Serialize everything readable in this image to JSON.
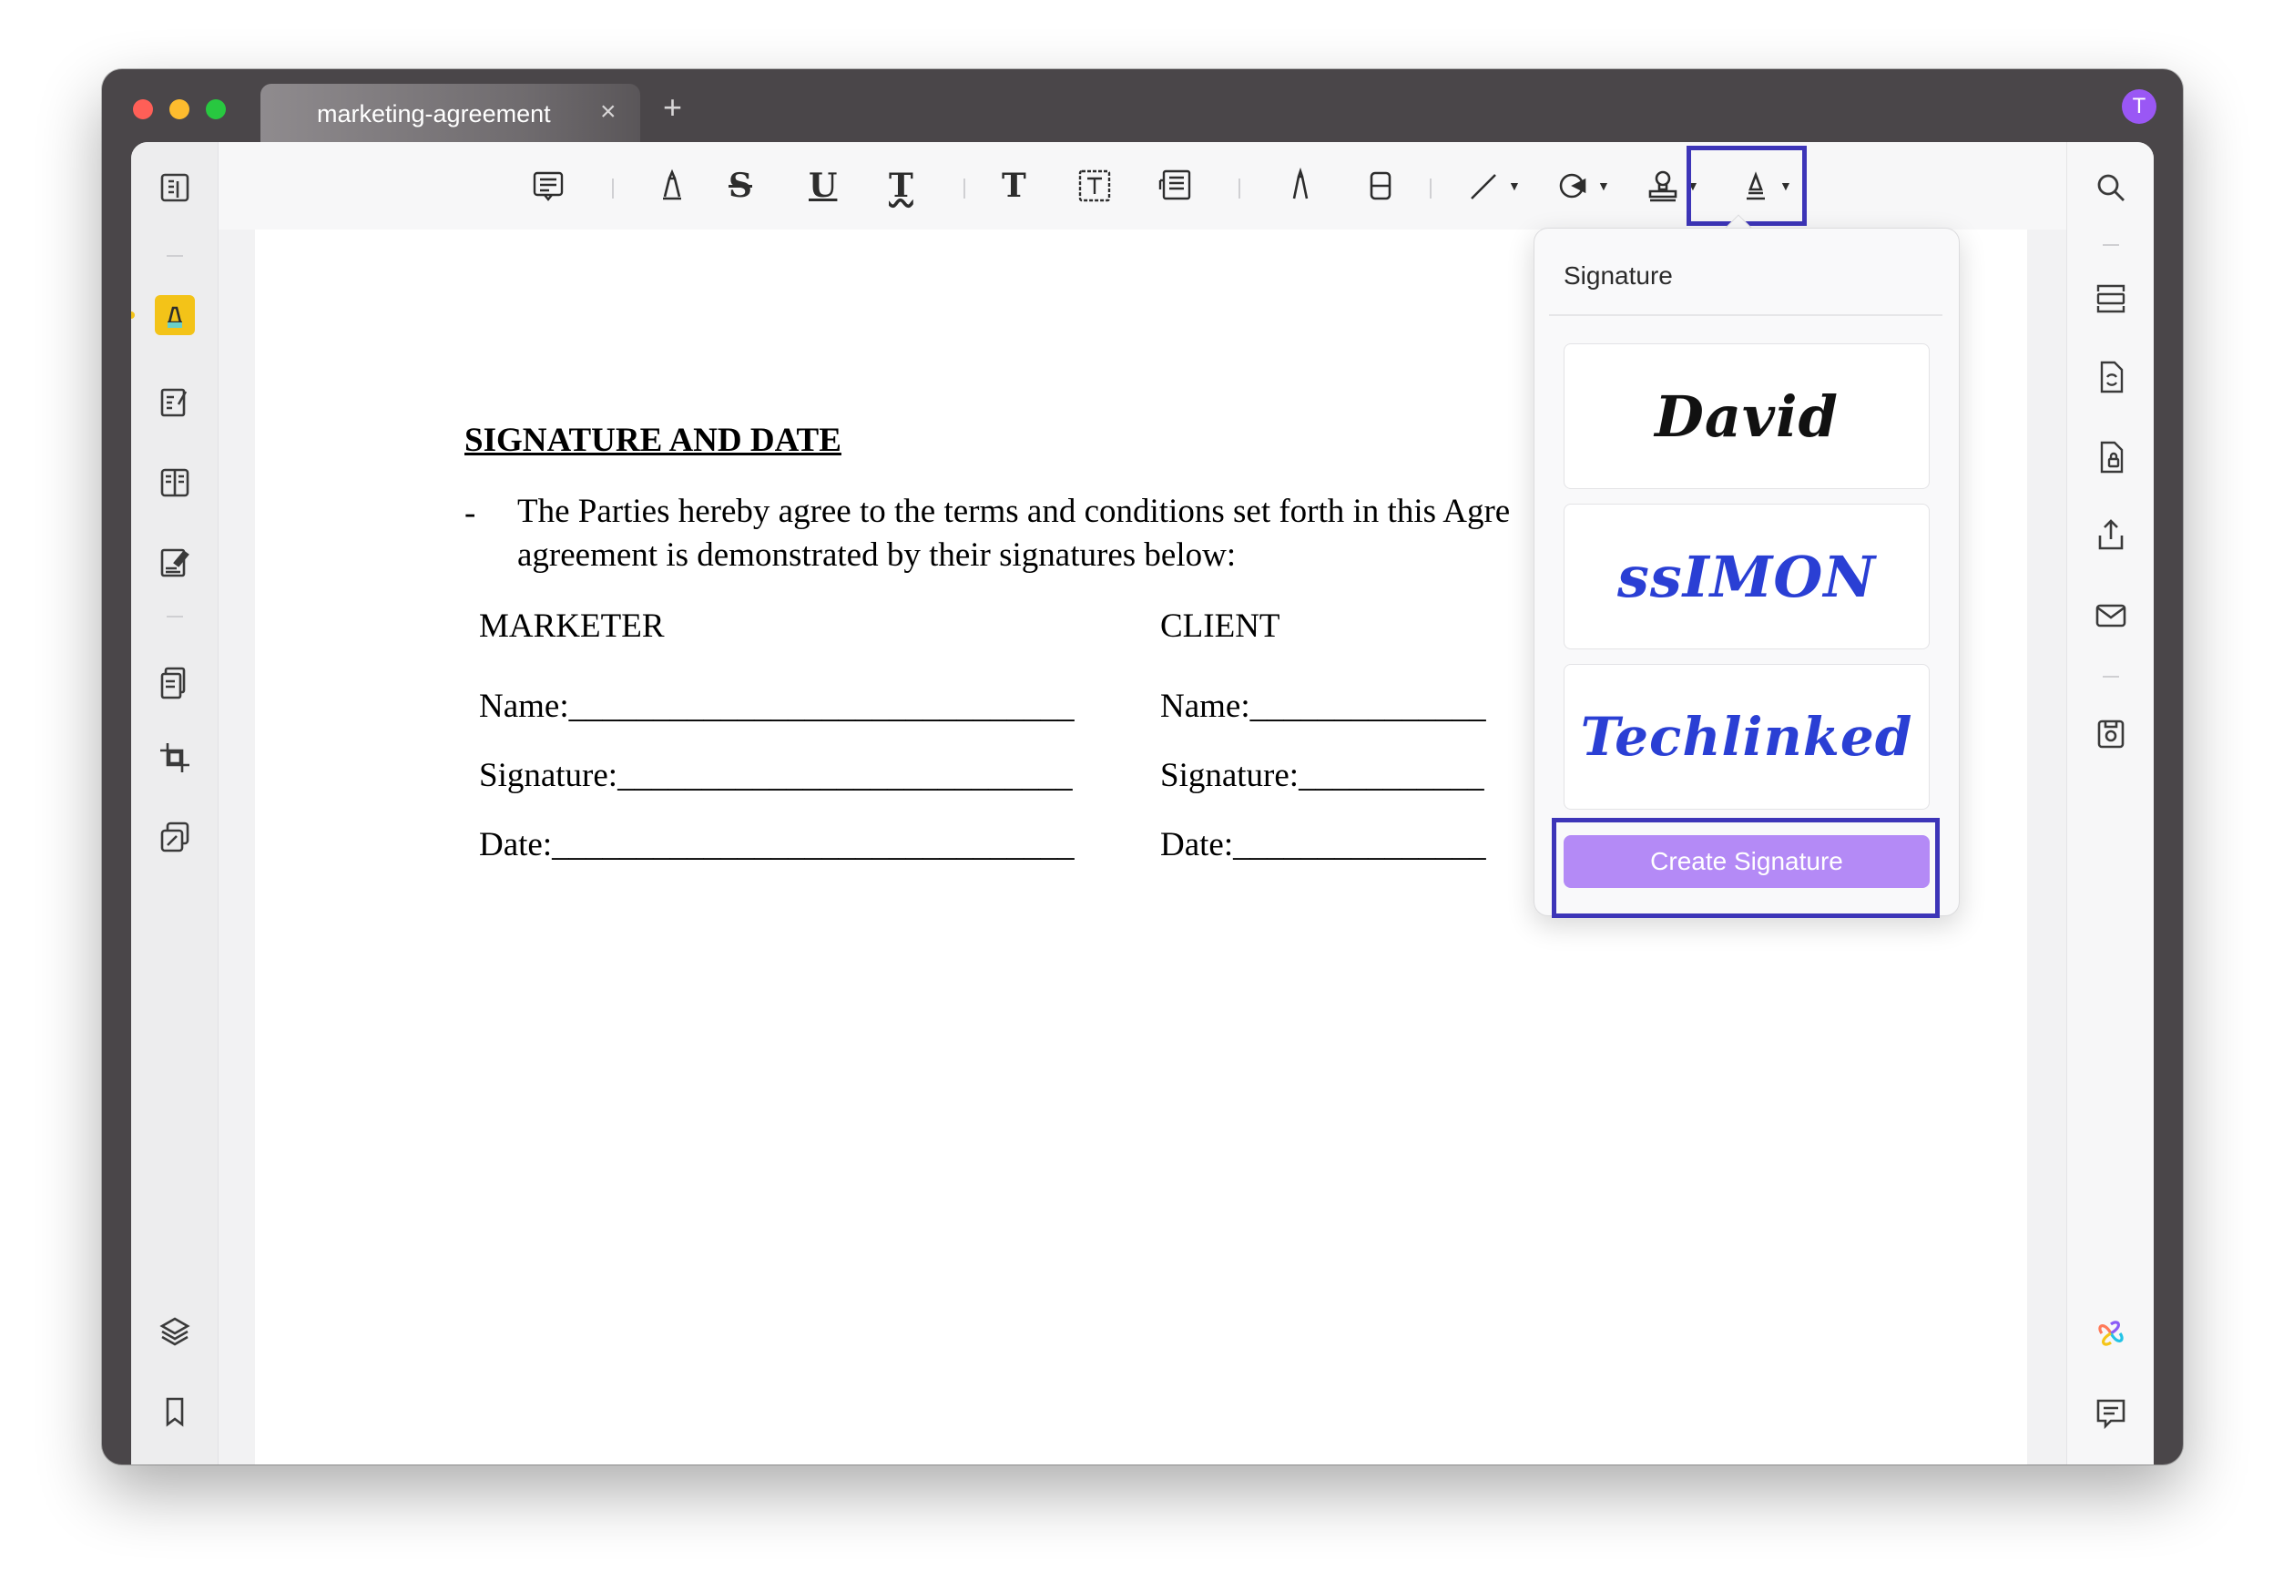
{
  "window": {
    "tab_title": "marketing-agreement",
    "tab_close": "×",
    "new_tab": "+",
    "avatar_initial": "T"
  },
  "toolbar": {
    "tools": [
      {
        "name": "note-icon"
      },
      {
        "name": "highlighter-icon"
      },
      {
        "name": "strikethrough",
        "label": "S"
      },
      {
        "name": "underline",
        "label": "U"
      },
      {
        "name": "squiggly-underline",
        "label": "T"
      },
      {
        "name": "text",
        "label": "T"
      },
      {
        "name": "text-box-icon"
      },
      {
        "name": "text-callout-icon"
      },
      {
        "name": "pencil-icon"
      },
      {
        "name": "eraser-icon"
      },
      {
        "name": "line-icon"
      },
      {
        "name": "shape-icon"
      },
      {
        "name": "stamp-icon"
      },
      {
        "name": "signature-icon",
        "active": true
      }
    ]
  },
  "document": {
    "heading": "SIGNATURE AND DATE",
    "bullet": "-",
    "paragraph_line1": "The Parties hereby agree to the terms and conditions set forth in this Agre",
    "paragraph_line2": "agreement is demonstrated by their signatures below:",
    "marketer_heading": "MARKETER",
    "client_heading": "CLIENT",
    "marketer_fields": [
      "Name:______________________________",
      "Signature:___________________________",
      "Date:_______________________________"
    ],
    "client_fields": [
      "Name:______________",
      "Signature:___________",
      "Date:_______________"
    ]
  },
  "signature_popover": {
    "title": "Signature",
    "signatures": [
      {
        "text": "David",
        "color": "#111111"
      },
      {
        "text": "ssIMON",
        "color": "#2a3fd4"
      },
      {
        "text": "Techlinked",
        "color": "#2a3fd4"
      }
    ],
    "create_button": "Create Signature"
  },
  "colors": {
    "accent_purple": "#b48af6",
    "highlight_box": "#3d35b8",
    "active_tool_yellow": "#f3c318"
  }
}
